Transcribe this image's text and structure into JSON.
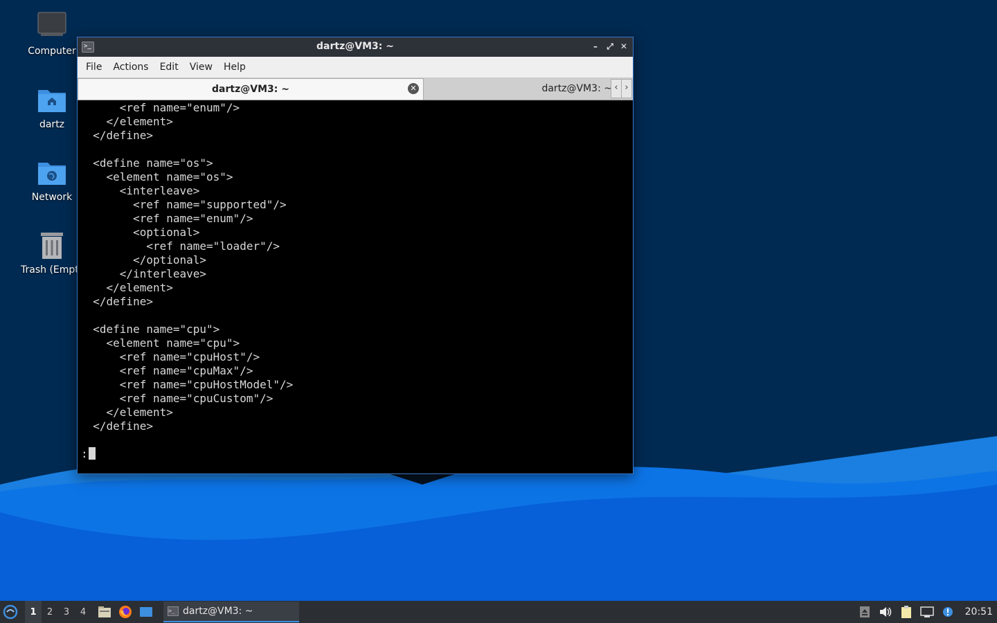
{
  "desktop": {
    "icons": [
      {
        "label": "Computer",
        "icon": "computer-icon"
      },
      {
        "label": "dartz",
        "icon": "home-folder-icon"
      },
      {
        "label": "Network",
        "icon": "network-folder-icon"
      },
      {
        "label": "Trash (Empty)",
        "icon": "trash-icon"
      }
    ]
  },
  "window": {
    "title": "dartz@VM3: ~",
    "icon": "terminal-icon",
    "controls": {
      "minimize": "–",
      "maximize": "⤢",
      "close": "✕"
    }
  },
  "menu": [
    "File",
    "Actions",
    "Edit",
    "View",
    "Help"
  ],
  "tabs": [
    {
      "label": "dartz@VM3: ~",
      "active": true,
      "close": "✕"
    },
    {
      "label": "dartz@VM3: ~",
      "active": false
    }
  ],
  "tab_scroll": {
    "left": "‹",
    "right": "›"
  },
  "terminal": {
    "lines": [
      "      <ref name=\"enum\"/>",
      "    </element>",
      "  </define>",
      "",
      "  <define name=\"os\">",
      "    <element name=\"os\">",
      "      <interleave>",
      "        <ref name=\"supported\"/>",
      "        <ref name=\"enum\"/>",
      "        <optional>",
      "          <ref name=\"loader\"/>",
      "        </optional>",
      "      </interleave>",
      "    </element>",
      "  </define>",
      "",
      "  <define name=\"cpu\">",
      "    <element name=\"cpu\">",
      "      <ref name=\"cpuHost\"/>",
      "      <ref name=\"cpuMax\"/>",
      "      <ref name=\"cpuHostModel\"/>",
      "      <ref name=\"cpuCustom\"/>",
      "    </element>",
      "  </define>"
    ],
    "prompt": ":"
  },
  "taskbar": {
    "workspaces": [
      "1",
      "2",
      "3",
      "4"
    ],
    "active_workspace": "1",
    "launchers": [
      "file-manager-icon",
      "firefox-icon",
      "desktop-icon"
    ],
    "task": {
      "label": "dartz@VM3: ~",
      "icon": "terminal-icon"
    },
    "tray": [
      "eject-icon",
      "volume-icon",
      "clipboard-icon",
      "network-icon",
      "update-notifier-icon"
    ],
    "clock": "20:51"
  },
  "colors": {
    "accent": "#3d8fe0",
    "titlebar": "#2d3138",
    "taskbar": "#2b2e33"
  }
}
